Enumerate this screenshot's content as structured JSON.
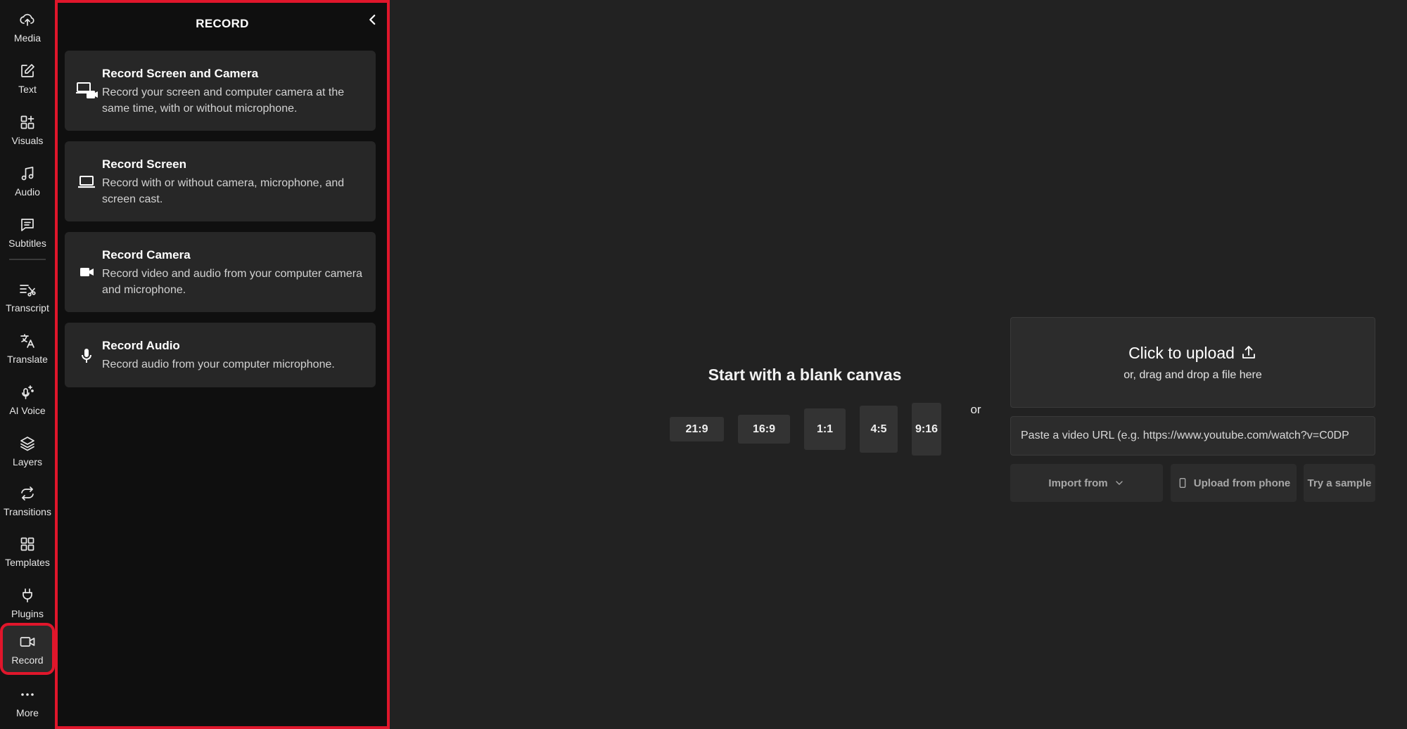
{
  "rail": {
    "items": [
      {
        "label": "Media",
        "icon": "upload-cloud-icon"
      },
      {
        "label": "Text",
        "icon": "edit-text-icon"
      },
      {
        "label": "Visuals",
        "icon": "shapes-icon"
      },
      {
        "label": "Audio",
        "icon": "music-note-icon"
      },
      {
        "label": "Subtitles",
        "icon": "speech-bubble-icon"
      },
      {
        "label": "Transcript",
        "icon": "transcript-scissors-icon"
      },
      {
        "label": "Translate",
        "icon": "translate-icon"
      },
      {
        "label": "AI Voice",
        "icon": "microphone-sparkle-icon"
      },
      {
        "label": "Layers",
        "icon": "layers-icon"
      },
      {
        "label": "Transitions",
        "icon": "loop-arrows-icon"
      },
      {
        "label": "Templates",
        "icon": "grid-icon"
      },
      {
        "label": "Plugins",
        "icon": "plug-icon"
      },
      {
        "label": "Record",
        "icon": "video-camera-icon"
      },
      {
        "label": "More",
        "icon": "ellipsis-icon"
      }
    ],
    "active": "Record"
  },
  "panel": {
    "title": "RECORD",
    "cards": [
      {
        "title": "Record Screen and Camera",
        "description": "Record your screen and computer camera at the same time, with or without microphone.",
        "icon": "screen-camera-icon"
      },
      {
        "title": "Record Screen",
        "description": "Record with or without camera, microphone, and screen cast.",
        "icon": "laptop-icon"
      },
      {
        "title": "Record Camera",
        "description": "Record video and audio from your computer camera and microphone.",
        "icon": "camera-icon"
      },
      {
        "title": "Record Audio",
        "description": "Record audio from your computer microphone.",
        "icon": "microphone-icon"
      }
    ]
  },
  "main": {
    "canvas_title": "Start with a blank canvas",
    "ratios": [
      "21:9",
      "16:9",
      "1:1",
      "4:5",
      "9:16"
    ],
    "or": "or",
    "upload": {
      "title": "Click to upload",
      "subtitle": "or, drag and drop a file here"
    },
    "url_placeholder": "Paste a video URL (e.g. https://www.youtube.com/watch?v=C0DP",
    "import_label": "Import from",
    "phone_label": "Upload from phone",
    "sample_label": "Try a sample"
  },
  "colors": {
    "accent": "#e0162b",
    "background": "#222222",
    "panel": "#0f0f0f",
    "card": "#272727"
  }
}
